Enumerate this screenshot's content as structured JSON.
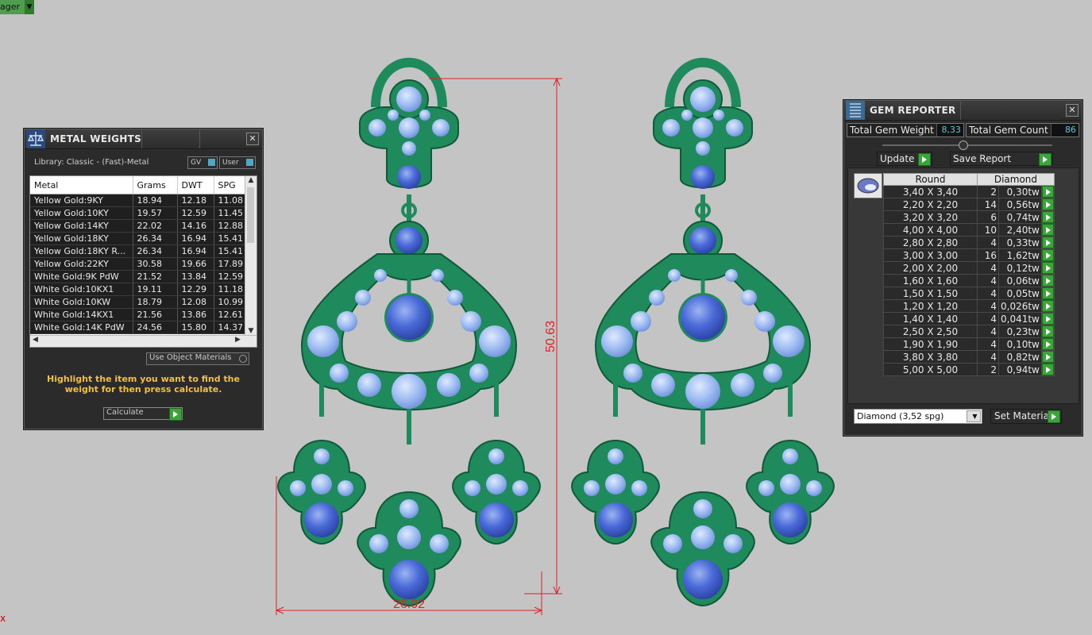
{
  "top_tab": {
    "label": "ager"
  },
  "dimensions": {
    "height": "50.63",
    "width": "26.02"
  },
  "metal_weights": {
    "title": "METAL WEIGHTS",
    "library": "Library: Classic - (Fast)-Metal",
    "toggle_gv": "GV",
    "toggle_user": "User",
    "columns": [
      "Metal",
      "Grams",
      "DWT",
      "SPG"
    ],
    "rows": [
      [
        "Yellow Gold:9KY",
        "18.94",
        "12.18",
        "11.08"
      ],
      [
        "Yellow Gold:10KY",
        "19.57",
        "12.59",
        "11.45"
      ],
      [
        "Yellow Gold:14KY",
        "22.02",
        "14.16",
        "12.88"
      ],
      [
        "Yellow Gold:18KY",
        "26.34",
        "16.94",
        "15.41"
      ],
      [
        "Yellow Gold:18KY R...",
        "26.34",
        "16.94",
        "15.41"
      ],
      [
        "Yellow Gold:22KY",
        "30.58",
        "19.66",
        "17.89"
      ],
      [
        "White Gold:9K PdW",
        "21.52",
        "13.84",
        "12.59"
      ],
      [
        "White Gold:10KX1",
        "19.11",
        "12.29",
        "11.18"
      ],
      [
        "White Gold:10KW",
        "18.79",
        "12.08",
        "10.99"
      ],
      [
        "White Gold:14KX1",
        "21.56",
        "13.86",
        "12.61"
      ],
      [
        "White Gold:14K PdW",
        "24.56",
        "15.80",
        "14.37"
      ]
    ],
    "use_object_materials": "Use Object Materials",
    "message": "Highlight the item you want to find the weight for then press calculate.",
    "calculate": "Calculate"
  },
  "gem_reporter": {
    "title": "GEM REPORTER",
    "total_weight_label": "Total Gem Weight",
    "total_weight_value": "8,33",
    "total_count_label": "Total Gem Count",
    "total_count_value": "86",
    "update": "Update",
    "save_report": "Save Report",
    "col_shape": "Round",
    "col_material": "Diamond",
    "rows": [
      [
        "3,40 X 3,40",
        "2",
        "0,30tw"
      ],
      [
        "2,20 X 2,20",
        "14",
        "0,56tw"
      ],
      [
        "3,20 X 3,20",
        "6",
        "0,74tw"
      ],
      [
        "4,00 X 4,00",
        "10",
        "2,40tw"
      ],
      [
        "2,80 X 2,80",
        "4",
        "0,33tw"
      ],
      [
        "3,00 X 3,00",
        "16",
        "1,62tw"
      ],
      [
        "2,00 X 2,00",
        "4",
        "0,12tw"
      ],
      [
        "1,60 X 1,60",
        "4",
        "0,06tw"
      ],
      [
        "1,50 X 1,50",
        "4",
        "0,05tw"
      ],
      [
        "1,20 X 1,20",
        "4",
        "0,026tw"
      ],
      [
        "1,40 X 1,40",
        "4",
        "0,041tw"
      ],
      [
        "2,50 X 2,50",
        "4",
        "0,23tw"
      ],
      [
        "1,90 X 1,90",
        "4",
        "0,10tw"
      ],
      [
        "3,80 X 3,80",
        "4",
        "0,82tw"
      ],
      [
        "5,00 X 5,00",
        "2",
        "0,94tw"
      ]
    ],
    "material_select": "Diamond     (3,52 spg)",
    "set_material": "Set Material"
  },
  "colors": {
    "metal": "#1f8a5c",
    "gem_light": "#9fc0f0",
    "gem_dark": "#3a5fd0",
    "dimension": "#dd2222"
  }
}
